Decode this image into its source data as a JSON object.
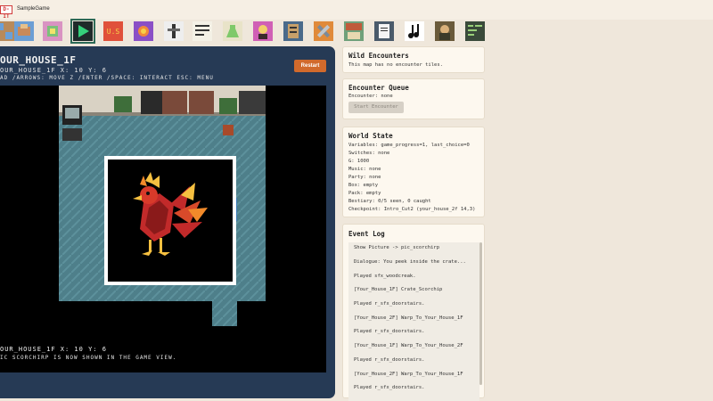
{
  "app": {
    "badge": "D-IT",
    "title": "SampleGame"
  },
  "toolbar": {
    "items": [
      {
        "name": "tileset"
      },
      {
        "name": "sprite-editor"
      },
      {
        "name": "play"
      },
      {
        "name": "fx"
      },
      {
        "name": "effects"
      },
      {
        "name": "animation"
      },
      {
        "name": "dialogue"
      },
      {
        "name": "items"
      },
      {
        "name": "characters"
      },
      {
        "name": "scripts"
      },
      {
        "name": "tools"
      },
      {
        "name": "map"
      },
      {
        "name": "document"
      },
      {
        "name": "music"
      },
      {
        "name": "gallery"
      },
      {
        "name": "code"
      }
    ],
    "active_index": 2,
    "fx_label": "U.S"
  },
  "game": {
    "map_title": "OUR_HOUSE_1F",
    "position": "OUR_HOUSE_1F   X: 10   Y: 6",
    "controls": "AD /ARROWS: MOVE   Z /ENTER /SPACE: INTERACT   ESC: MENU",
    "restart_label": "Restart",
    "bottom_position": "OUR_HOUSE_1F   X: 10   Y: 6",
    "status": "IC SCORCHIRP IS NOW SHOWN IN THE GAME VIEW."
  },
  "wild_encounters": {
    "title": "Wild Encounters",
    "text": "This map has no encounter tiles."
  },
  "encounter_queue": {
    "title": "Encounter Queue",
    "text": "Encounter: none",
    "button_label": "Start Encounter"
  },
  "world_state": {
    "title": "World State",
    "lines": [
      "Variables: game_progress=1, last_choice=0",
      "Switches: none",
      "G: 1000",
      "Music: none",
      "Party: none",
      "Box: empty",
      "Pack: empty",
      "Bestiary: 0/5 seen, 0 caught",
      "Checkpoint: Intro_Cut2 (your_house_2f 14,3)"
    ]
  },
  "event_log": {
    "title": "Event Log",
    "entries": [
      "Show Picture -> pic_scorchirp",
      "Dialogue: You peek inside the crate...",
      "Played sfx_woodcreak.",
      "[Your_House_1F] Crate_Scorchip",
      "Played r_sfx_doorstairs.",
      "[Your_House_2F] Warp_To_Your_House_1F",
      "Played r_sfx_doorstairs.",
      "[Your_House_1F] Warp_To_Your_House_2F",
      "Played r_sfx_doorstairs.",
      "[Your_House_2F] Warp_To_Your_House_1F",
      "Played r_sfx_doorstairs."
    ]
  },
  "colors": {
    "game_panel": "#263a55",
    "floor": "#4e7f8a",
    "accent": "#d16a2c"
  }
}
